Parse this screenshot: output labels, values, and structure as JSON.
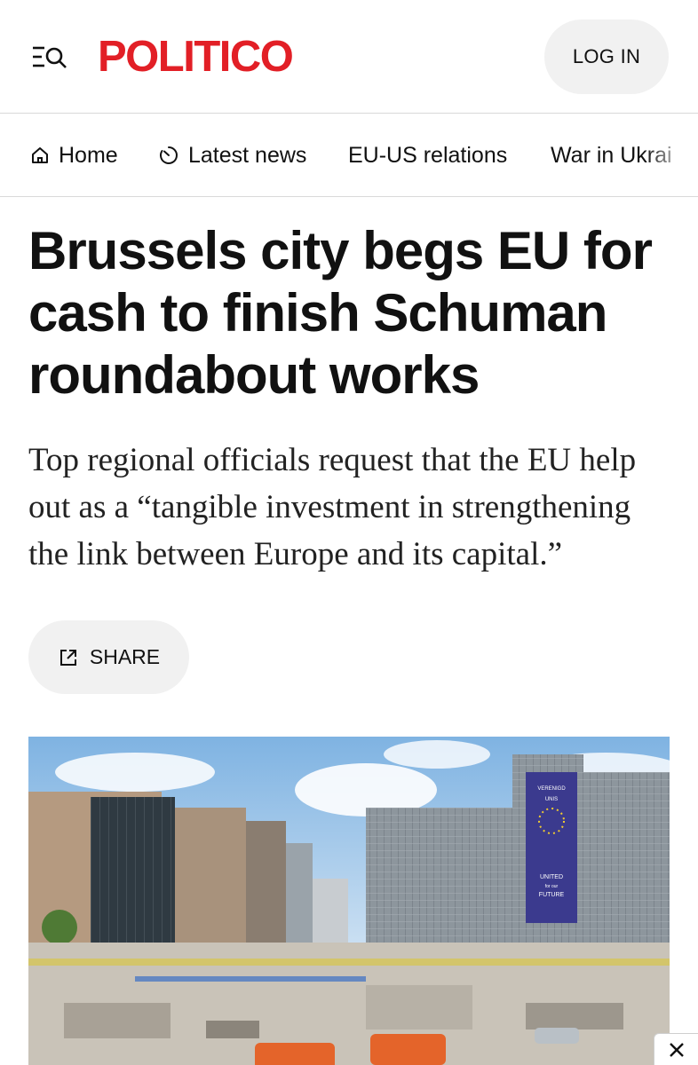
{
  "header": {
    "logo": "POLITICO",
    "login_label": "LOG IN",
    "menu_icon": "menu-search-icon"
  },
  "nav": {
    "items": [
      {
        "label": "Home",
        "icon": "home-icon"
      },
      {
        "label": "Latest news",
        "icon": "clock-icon"
      },
      {
        "label": "EU-US relations"
      },
      {
        "label": "War in Ukrai"
      }
    ]
  },
  "article": {
    "headline": "Brussels city begs EU for cash to finish Schuman roundabout works",
    "dek": "Top regional officials request that the EU help out as a “tangible investment in strengthening the link between Europe and its capital.”",
    "share_label": "SHARE",
    "share_icon": "external-link-icon"
  },
  "photo": {
    "banner_lines": [
      "VERENIGD",
      "UNIS",
      "UNITED",
      "for our",
      "FUTURE"
    ]
  },
  "overlay": {
    "close_icon": "close-icon"
  },
  "colors": {
    "brand": "#e21f26",
    "pill_bg": "#f1f1f1",
    "text": "#111111"
  }
}
